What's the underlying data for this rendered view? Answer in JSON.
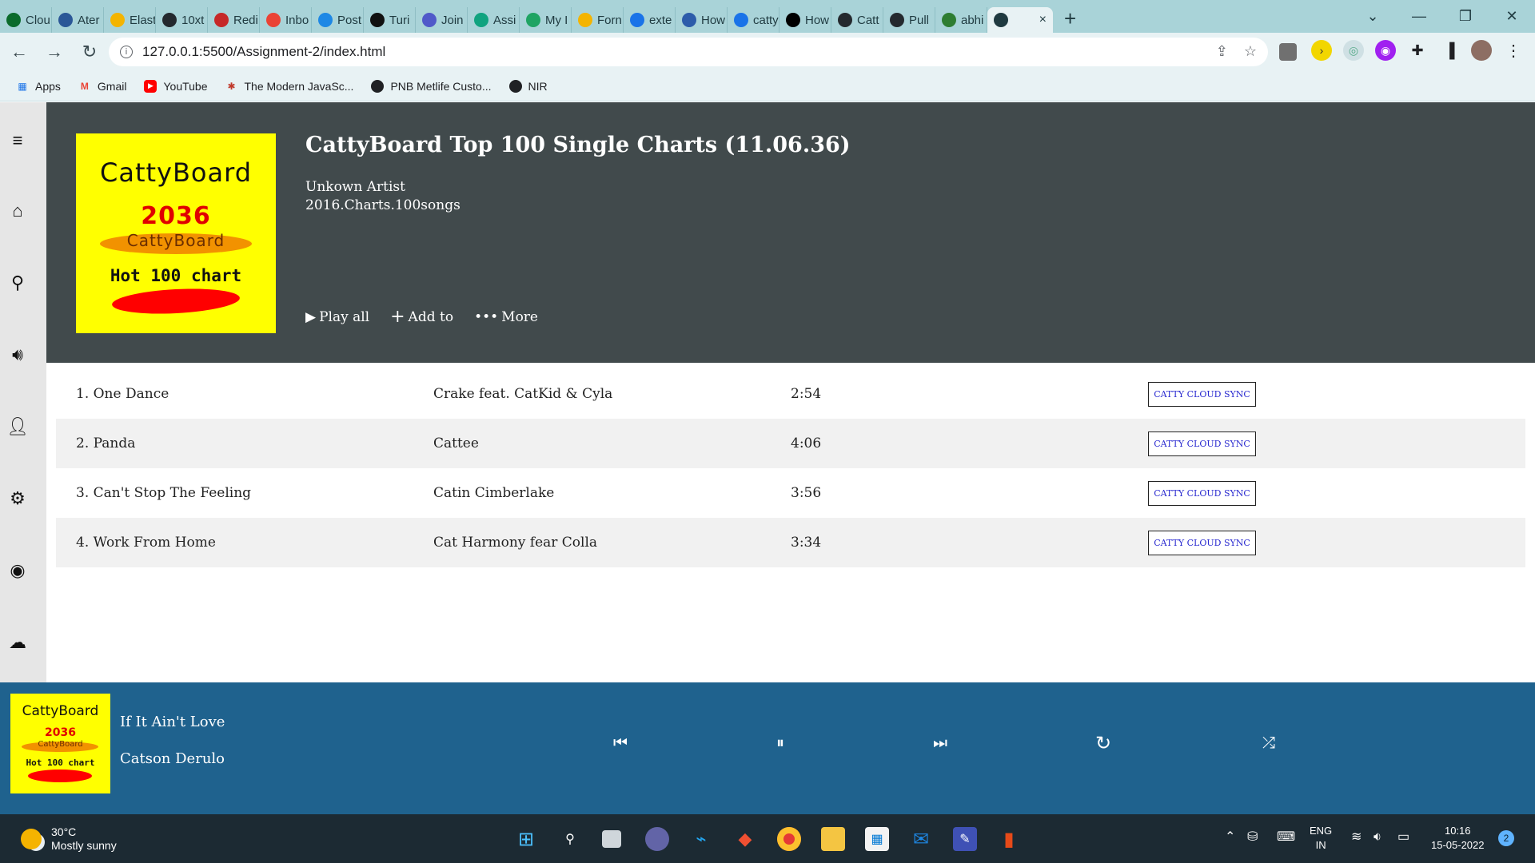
{
  "browser": {
    "tabs": [
      "Clou",
      "Ater",
      "Elast",
      "10xt",
      "Redi",
      "Inbo",
      "Post",
      "Turi",
      "Join",
      "Assi",
      "My I",
      "Forn",
      "exte",
      "How",
      "catty",
      "How",
      "Catt",
      "Pull",
      "abhi"
    ],
    "tab_colors": [
      "#0b6b2c",
      "#2b5797",
      "#f4b400",
      "#24292e",
      "#c62828",
      "#ea4335",
      "#1e88e5",
      "#111111",
      "#5059c9",
      "#10a37f",
      "#1fa463",
      "#f4b400",
      "#1a73e8",
      "#2d5caa",
      "#1a73e8",
      "#000000",
      "#24292e",
      "#24292e",
      "#2e7d32"
    ],
    "active_tab_close": "×",
    "new_tab": "+",
    "url": "127.0.0.1:5500/Assignment-2/index.html",
    "bookmarks": [
      "Apps",
      "Gmail",
      "YouTube",
      "The Modern JavaSc...",
      "PNB Metlife Custo...",
      "NIR"
    ]
  },
  "album": {
    "cover_title": "CattyBoard",
    "cover_year": "2036",
    "cover_brand": "CattyBoard",
    "cover_subtitle": "Hot 100 chart",
    "title": "CattyBoard Top 100 Single Charts (11.06.36)",
    "artist": "Unkown Artist",
    "meta": "2016.Charts.100songs",
    "actions": {
      "play_all": "Play all",
      "add_to": "Add to",
      "more": "More"
    }
  },
  "tracks": [
    {
      "title": "1. One Dance",
      "artist": "Crake feat. CatKid & Cyla",
      "duration": "2:54",
      "sync": "CATTY CLOUD SYNC"
    },
    {
      "title": "2. Panda",
      "artist": "Cattee",
      "duration": "4:06",
      "sync": "CATTY CLOUD SYNC"
    },
    {
      "title": "3. Can't Stop The Feeling",
      "artist": "Catin Cimberlake",
      "duration": "3:56",
      "sync": "CATTY CLOUD SYNC"
    },
    {
      "title": "4. Work From Home",
      "artist": "Cat Harmony fear Colla",
      "duration": "3:34",
      "sync": "CATTY CLOUD SYNC"
    }
  ],
  "player": {
    "cover_title": "CattyBoard",
    "cover_year": "2036",
    "cover_brand": "CattyBoard",
    "cover_subtitle": "Hot 100 chart",
    "now_playing_title": "If It Ain't Love",
    "now_playing_artist": "Catson Derulo"
  },
  "taskbar": {
    "temperature": "30°C",
    "weather": "Mostly sunny",
    "language": "ENG",
    "region": "IN",
    "time": "10:16",
    "date": "15-05-2022",
    "notifications": "2"
  },
  "colors": {
    "hero_bg": "#414a4c",
    "player_bg": "#1f628e",
    "cover_bg": "#ffff00",
    "sync_text": "#2a2ad0"
  }
}
